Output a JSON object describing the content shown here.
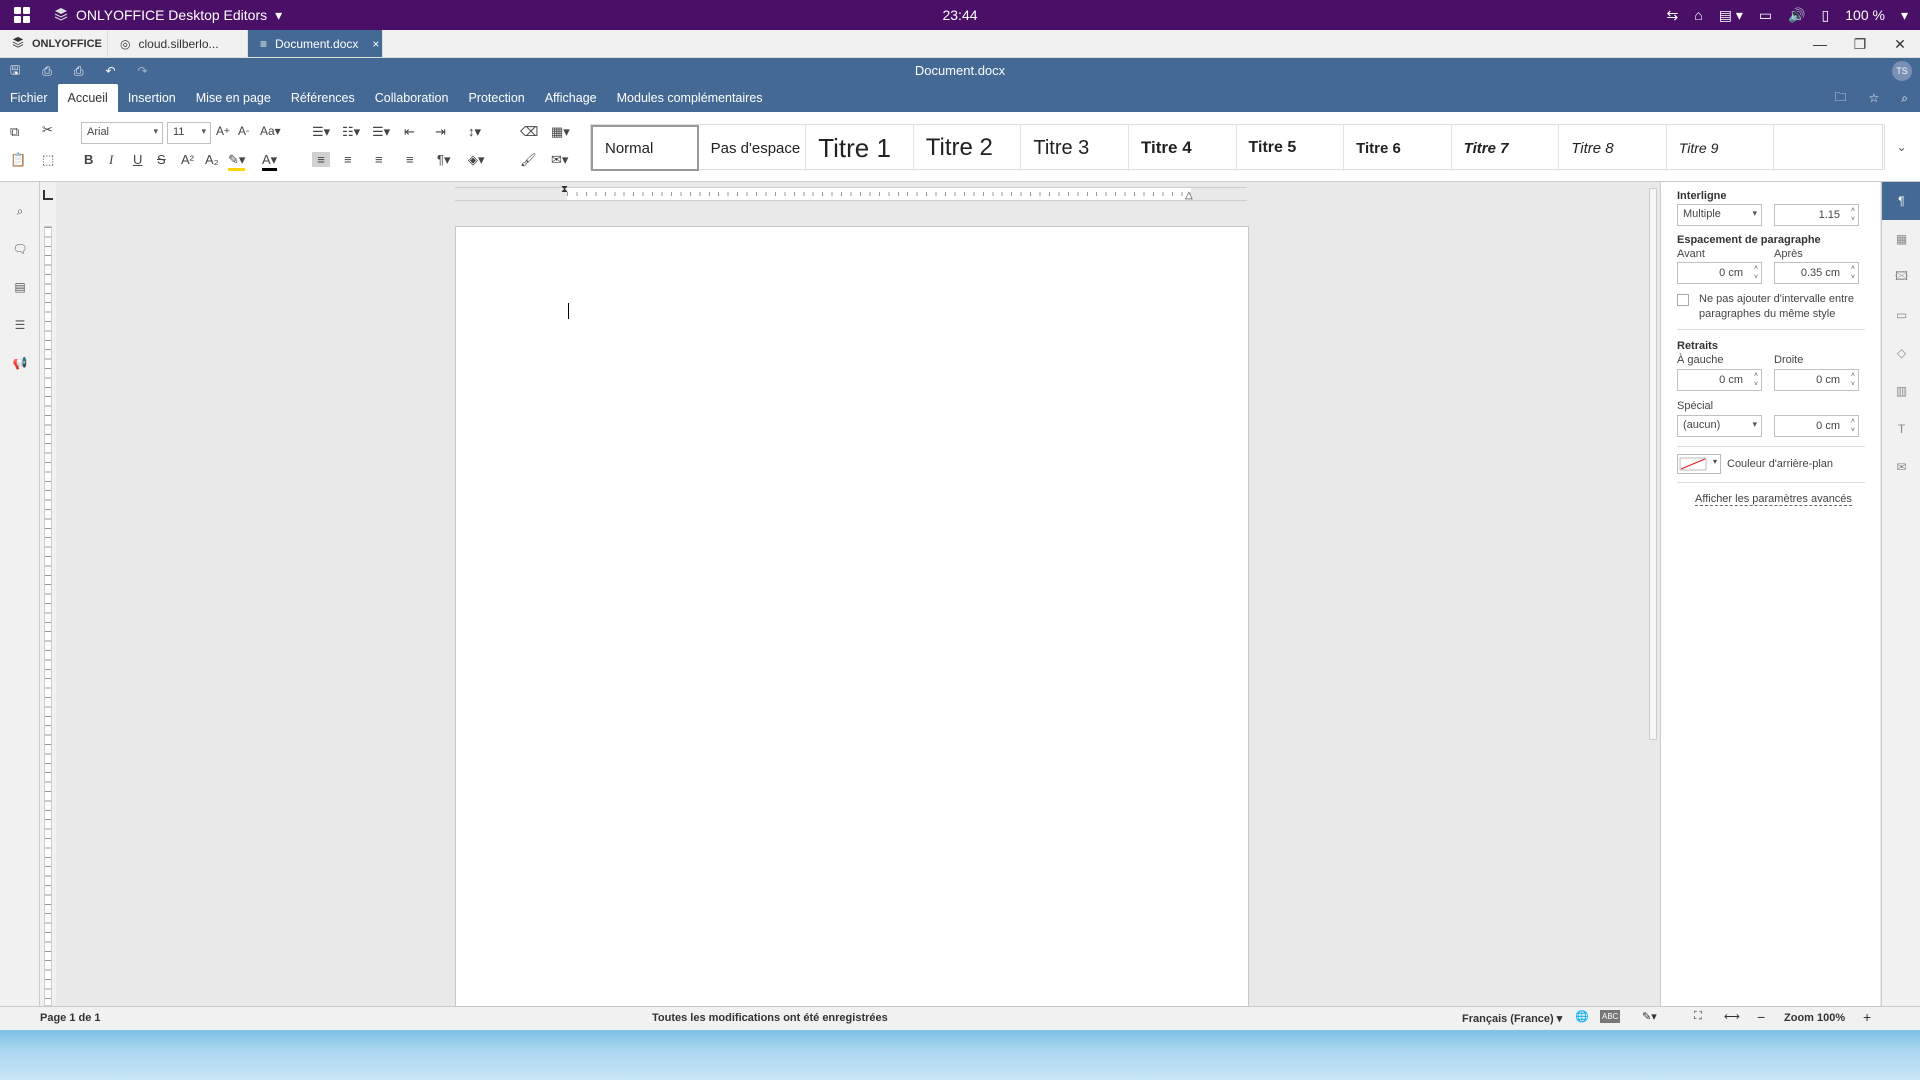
{
  "system_bar": {
    "app_name": "ONLYOFFICE Desktop Editors",
    "clock": "23:44",
    "battery": "100 %",
    "icons": [
      "apps-grid-icon",
      "onlyoffice-logo-icon",
      "chevron-down-icon",
      "network-icon",
      "home-icon",
      "clipboard-icon",
      "window-icon",
      "volume-icon",
      "battery-icon"
    ]
  },
  "tabs": [
    {
      "label": "ONLYOFFICE",
      "icon": "onlyoffice-logo-icon"
    },
    {
      "label": "cloud.silberlo...",
      "icon": "cloud-icon"
    },
    {
      "label": "Document.docx",
      "icon": "document-icon",
      "close": "×"
    }
  ],
  "window_controls": {
    "minimize": "—",
    "restore": "❐",
    "close": "✕"
  },
  "title": {
    "document": "Document.docx",
    "avatar": "TS"
  },
  "menu": {
    "items": [
      "Fichier",
      "Accueil",
      "Insertion",
      "Mise en page",
      "Références",
      "Collaboration",
      "Protection",
      "Affichage",
      "Modules complémentaires"
    ],
    "active": "Accueil"
  },
  "toolbar": {
    "font_name": "Arial",
    "font_size": "11",
    "styles": [
      "Normal",
      "Pas d'espace",
      "Titre 1",
      "Titre 2",
      "Titre 3",
      "Titre 4",
      "Titre 5",
      "Titre 6",
      "Titre 7",
      "Titre 8",
      "Titre 9"
    ]
  },
  "right_panel": {
    "line_spacing_header": "Interligne",
    "line_spacing_mode": "Multiple",
    "line_spacing_value": "1.15",
    "para_spacing_header": "Espacement de paragraphe",
    "before_label": "Avant",
    "before_value": "0 cm",
    "after_label": "Après",
    "after_value": "0.35 cm",
    "no_interval_checkbox": "Ne pas ajouter d'intervalle entre paragraphes du même style",
    "indents_header": "Retraits",
    "left_label": "À gauche",
    "left_value": "0 cm",
    "right_label": "Droite",
    "right_value": "0 cm",
    "special_label": "Spécial",
    "special_value": "(aucun)",
    "special_size": "0 cm",
    "bg_color_label": "Couleur d'arrière-plan",
    "advanced_link": "Afficher les paramètres avancés"
  },
  "status": {
    "page": "Page 1 de 1",
    "saved": "Toutes les modifications ont été enregistrées",
    "language": "Français (France)",
    "zoom": "Zoom 100%"
  },
  "colors": {
    "header": "#446995",
    "system_bar": "#4a0f67"
  }
}
